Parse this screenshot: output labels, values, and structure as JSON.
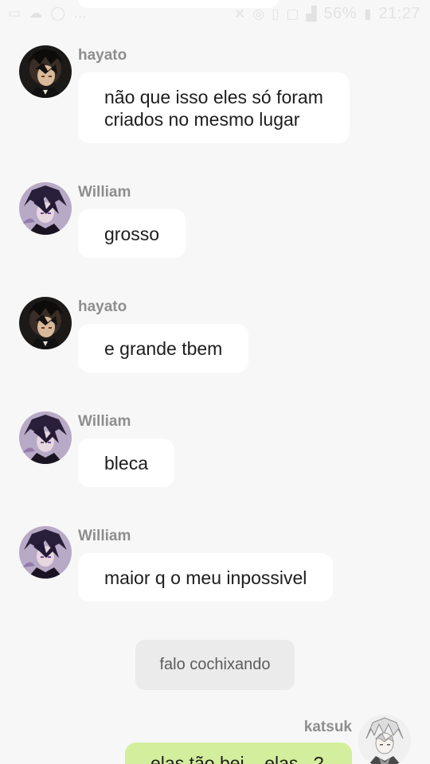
{
  "status_bar": {
    "battery_percent": "56%",
    "time": "21:27"
  },
  "messages": [
    {
      "sender": "hayato",
      "avatar": "hayato-avatar",
      "text": "não que isso eles só foram\ncriados no mesmo lugar"
    },
    {
      "sender": "William",
      "avatar": "william-avatar",
      "text": "grosso"
    },
    {
      "sender": "hayato",
      "avatar": "hayato-avatar",
      "text": "e grande tbem"
    },
    {
      "sender": "William",
      "avatar": "william-avatar",
      "text": "bleca"
    },
    {
      "sender": "William",
      "avatar": "william-avatar",
      "text": "maior q o meu inpossivel"
    }
  ],
  "system_message": "falo cochixando",
  "self_message": {
    "sender": "katsuk",
    "avatar": "katsuk-avatar",
    "text_partial": "elas tão bei... elas...?"
  },
  "colors": {
    "background": "#f7f7f7",
    "bubble_incoming": "#ffffff",
    "bubble_outgoing": "#d3ee9c",
    "system_pill": "#ebebeb",
    "sender_name": "#8e8e8e"
  }
}
